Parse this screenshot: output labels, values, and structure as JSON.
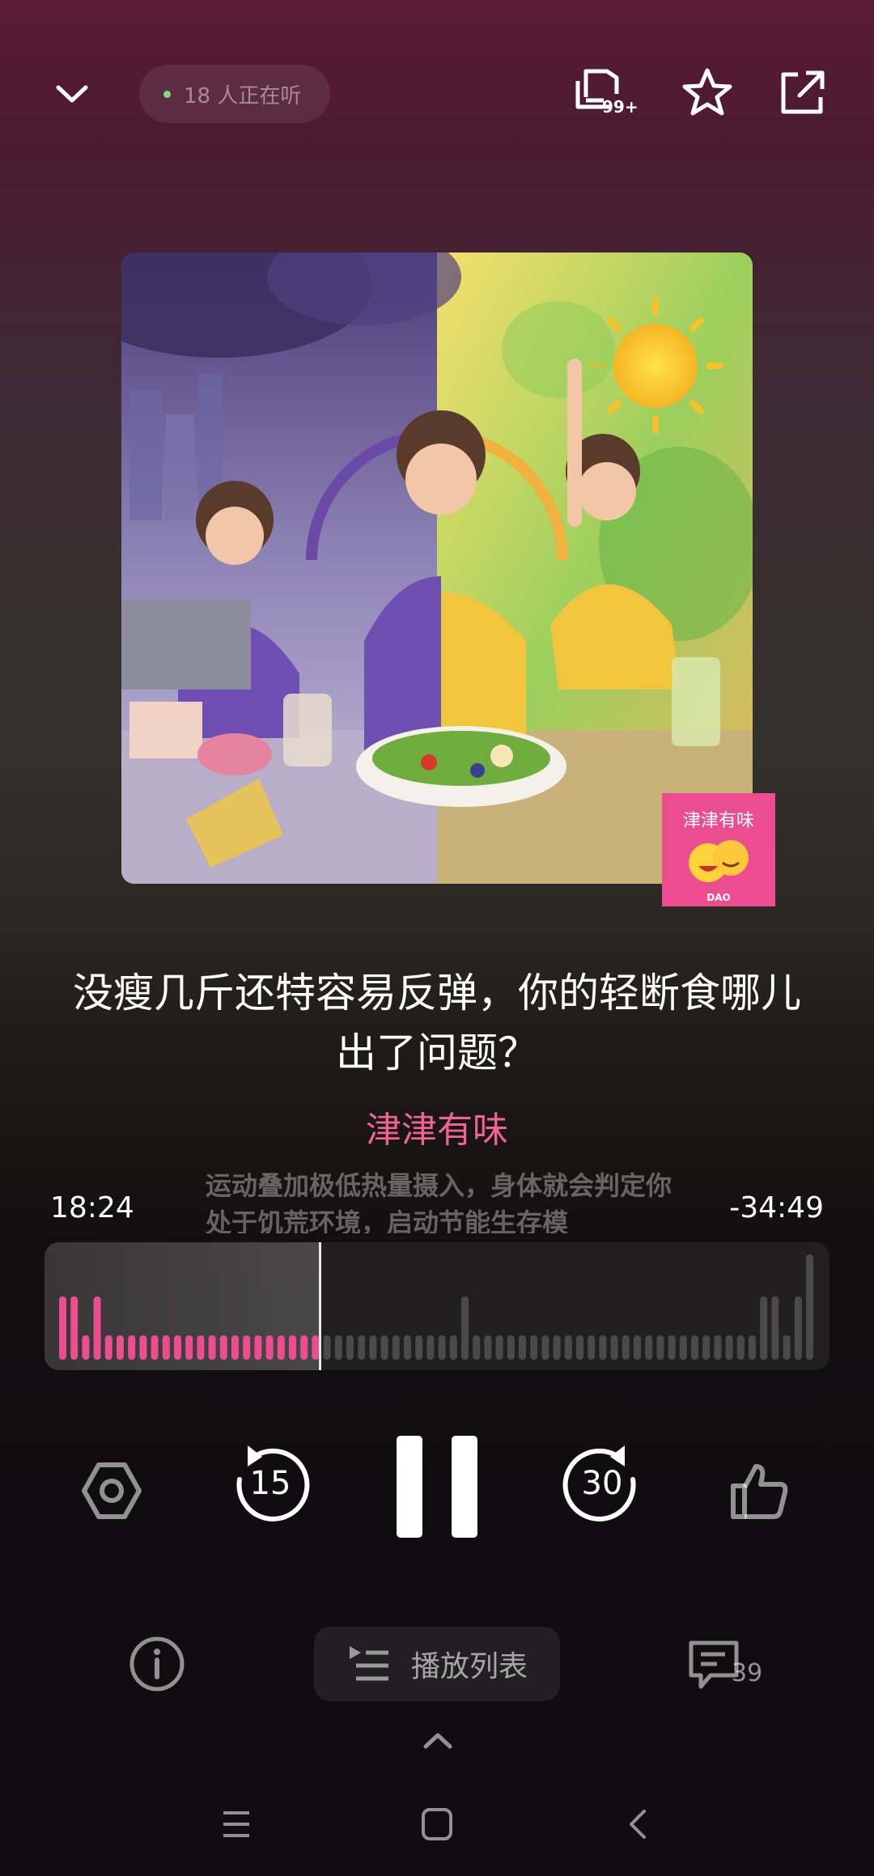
{
  "header": {
    "listeners_text": "18 人正在听",
    "subscribe_badge": "99+"
  },
  "episode": {
    "title": "没瘦几斤还特容易反弹，你的轻断食哪儿出了问题？",
    "author": "津津有味",
    "podcast_logo_text": "津津有味",
    "podcast_logo_brand": "DAO"
  },
  "player": {
    "elapsed": "18:24",
    "remaining": "-34:49",
    "lyric": "运动叠加极低热量摄入，身体就会判定你处于饥荒环境，启动节能生存模",
    "progress_fraction": 0.35,
    "rewind_seconds": "15",
    "forward_seconds": "30"
  },
  "bottom": {
    "playlist_label": "播放列表",
    "comment_count": "39"
  },
  "colors": {
    "accent": "#f06394",
    "played_bar": "#ec4d8f",
    "unplayed_bar": "#4a4a4a"
  }
}
